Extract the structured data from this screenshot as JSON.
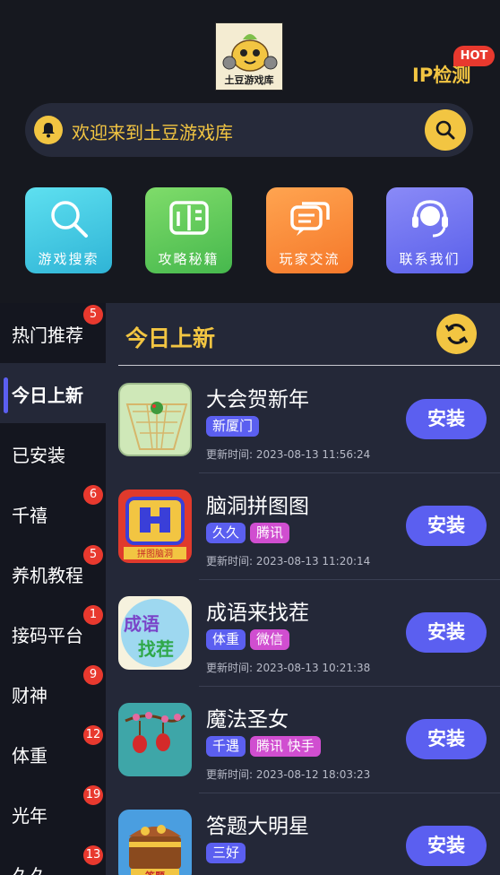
{
  "header": {
    "logo_text": "土豆游戏库",
    "ip_label": "IP检测",
    "hot_badge": "HOT"
  },
  "search": {
    "text": "欢迎来到土豆游戏库"
  },
  "quick_actions": [
    {
      "label": "游戏搜索",
      "icon": "search-icon"
    },
    {
      "label": "攻略秘籍",
      "icon": "book-icon"
    },
    {
      "label": "玩家交流",
      "icon": "chat-icon"
    },
    {
      "label": "联系我们",
      "icon": "headset-icon"
    }
  ],
  "sidebar": {
    "items": [
      {
        "label": "热门推荐",
        "badge": "5"
      },
      {
        "label": "今日上新",
        "badge": ""
      },
      {
        "label": "已安装",
        "badge": ""
      },
      {
        "label": "千禧",
        "badge": "6"
      },
      {
        "label": "养机教程",
        "badge": "5"
      },
      {
        "label": "接码平台",
        "badge": "1"
      },
      {
        "label": "财神",
        "badge": "9"
      },
      {
        "label": "体重",
        "badge": "12"
      },
      {
        "label": "光年",
        "badge": "19"
      },
      {
        "label": "久久",
        "badge": "13"
      }
    ]
  },
  "main": {
    "title": "今日上新",
    "install_label": "安装",
    "games": [
      {
        "name": "大会贺新年",
        "tags": [
          "新厦门"
        ],
        "time": "更新时间: 2023-08-13 11:56:24"
      },
      {
        "name": "脑洞拼图图",
        "tags": [
          "久久",
          "腾讯"
        ],
        "time": "更新时间: 2023-08-13 11:20:14"
      },
      {
        "name": "成语来找茬",
        "tags": [
          "体重",
          "微信"
        ],
        "time": "更新时间: 2023-08-13 10:21:38"
      },
      {
        "name": "魔法圣女",
        "tags": [
          "千遇",
          "腾讯 快手"
        ],
        "time": "更新时间: 2023-08-12 18:03:23"
      },
      {
        "name": "答题大明星",
        "tags": [
          "三好"
        ],
        "time": ""
      }
    ],
    "icon_texts": [
      "拼图脑洞",
      "成语",
      "找茬",
      "答题"
    ]
  },
  "colors": {
    "accent_yellow": "#f2c542",
    "accent_blue": "#5b5ff0",
    "badge_red": "#e8392e",
    "tag_pink": "#d04ed0"
  }
}
